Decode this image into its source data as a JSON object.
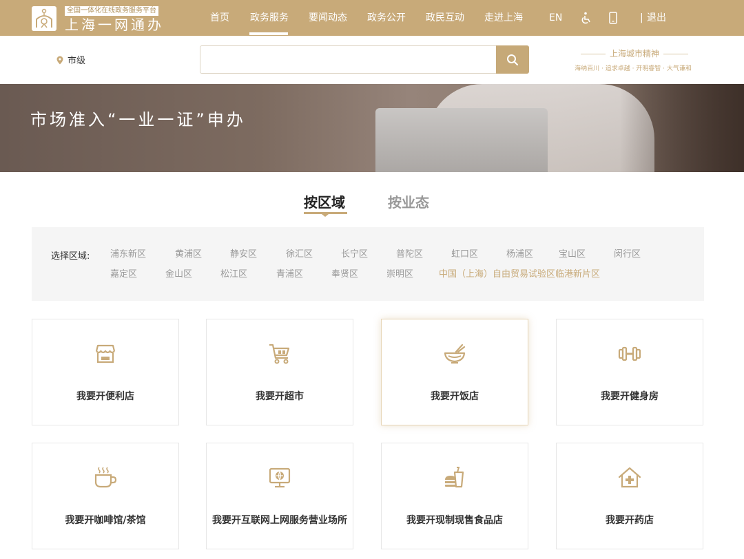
{
  "header": {
    "logo_sub": "全国一体化在线政务服务平台",
    "logo_main": "上海一网通办",
    "nav": [
      "首页",
      "政务服务",
      "要闻动态",
      "政务公开",
      "政民互动",
      "走进上海"
    ],
    "active_nav_index": 1,
    "lang": "EN",
    "logout": "退出"
  },
  "search": {
    "location": "市级",
    "placeholder": "",
    "spirit_title": "上海城市精神",
    "spirit_sub": "海纳百川 · 追求卓越 · 开明睿智 · 大气谦和"
  },
  "banner": {
    "title": "市场准入“一业一证”申办"
  },
  "tabs": [
    {
      "label": "按区域",
      "active": true
    },
    {
      "label": "按业态",
      "active": false
    }
  ],
  "region_filter": {
    "label": "选择区域:",
    "row1": [
      "浦东新区",
      "黄浦区",
      "静安区",
      "徐汇区",
      "长宁区",
      "普陀区",
      "虹口区",
      "杨浦区",
      "宝山区",
      "闵行区"
    ],
    "row2": [
      "嘉定区",
      "金山区",
      "松江区",
      "青浦区",
      "奉贤区",
      "崇明区",
      "中国（上海）自由贸易试验区临港新片区"
    ],
    "active": "中国（上海）自由贸易试验区临港新片区"
  },
  "cards": [
    {
      "label": "我要开便利店",
      "icon": "store-icon"
    },
    {
      "label": "我要开超市",
      "icon": "shopping-cart-icon"
    },
    {
      "label": "我要开饭店",
      "icon": "bowl-icon"
    },
    {
      "label": "我要开健身房",
      "icon": "dumbbell-icon"
    },
    {
      "label": "我要开咖啡馆/茶馆",
      "icon": "coffee-cup-icon"
    },
    {
      "label": "我要开互联网上网服务营业场所",
      "icon": "computer-icon"
    },
    {
      "label": "我要开现制现售食品店",
      "icon": "fast-food-icon"
    },
    {
      "label": "我要开药店",
      "icon": "pharmacy-icon"
    }
  ],
  "colors": {
    "brand_gold": "#c8aa79",
    "filter_bg": "#f5f5f5"
  }
}
